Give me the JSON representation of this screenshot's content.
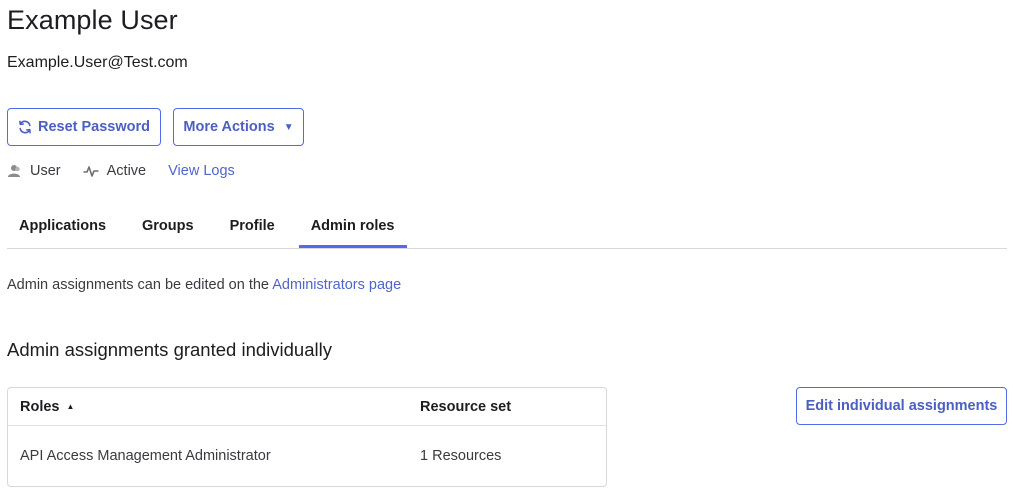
{
  "user": {
    "name": "Example User",
    "email": "Example.User@Test.com"
  },
  "actions": {
    "reset_password": "Reset Password",
    "more_actions": "More Actions"
  },
  "meta": {
    "type": "User",
    "status": "Active",
    "view_logs": "View Logs"
  },
  "tabs": [
    {
      "label": "Applications",
      "active": false
    },
    {
      "label": "Groups",
      "active": false
    },
    {
      "label": "Profile",
      "active": false
    },
    {
      "label": "Admin roles",
      "active": true
    }
  ],
  "notice": {
    "text": "Admin assignments can be edited on the ",
    "link": "Administrators page"
  },
  "section": {
    "title": "Admin assignments granted individually",
    "edit_button": "Edit individual assignments"
  },
  "table": {
    "columns": [
      "Roles",
      "Resource set"
    ],
    "rows": [
      [
        "API Access Management Administrator",
        "1 Resources"
      ]
    ]
  },
  "icons": {
    "reset": "refresh-icon",
    "caret": "caret-down-icon",
    "user": "user-icon",
    "status": "activity-icon",
    "sort": "sort-ascending-icon"
  },
  "colors": {
    "accent": "#546be7",
    "link": "#5065c9",
    "text": "#1d1d21"
  }
}
